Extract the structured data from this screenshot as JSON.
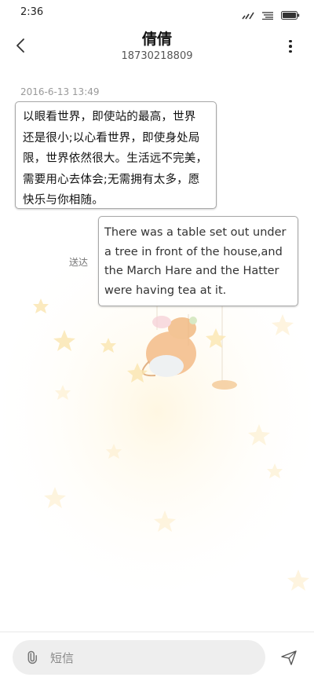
{
  "status_bar": {
    "time": "2:36",
    "icons": [
      "signal-icon",
      "wifi-icon",
      "battery-icon"
    ]
  },
  "header": {
    "contact_name": "倩倩",
    "phone_number": "18730218809",
    "back_icon": "chevron-left-icon",
    "more_icon": "more-vertical-icon"
  },
  "conversation": {
    "timestamp": "2016-6-13 13:49",
    "messages": [
      {
        "direction": "incoming",
        "text": "以眼看世界，即使站的最高，世界\n还是很小;以心看世界，即使身处局\n限，世界依然很大。生活远不完美，\n需要用心去体会;无需拥有太多，愿\n快乐与你相随。"
      },
      {
        "direction": "outgoing",
        "status": "送达",
        "text": "There was a table set out under\na tree in front of the house,and\nthe March Hare and the Hatter\nwere having tea at it."
      }
    ]
  },
  "composer": {
    "placeholder": "短信",
    "attach_icon": "paperclip-icon",
    "send_icon": "send-icon"
  },
  "colors": {
    "background": "#ffffff",
    "bubble_border": "#a7a7a7",
    "timestamp_text": "#999999",
    "input_background": "#eeeeee"
  }
}
